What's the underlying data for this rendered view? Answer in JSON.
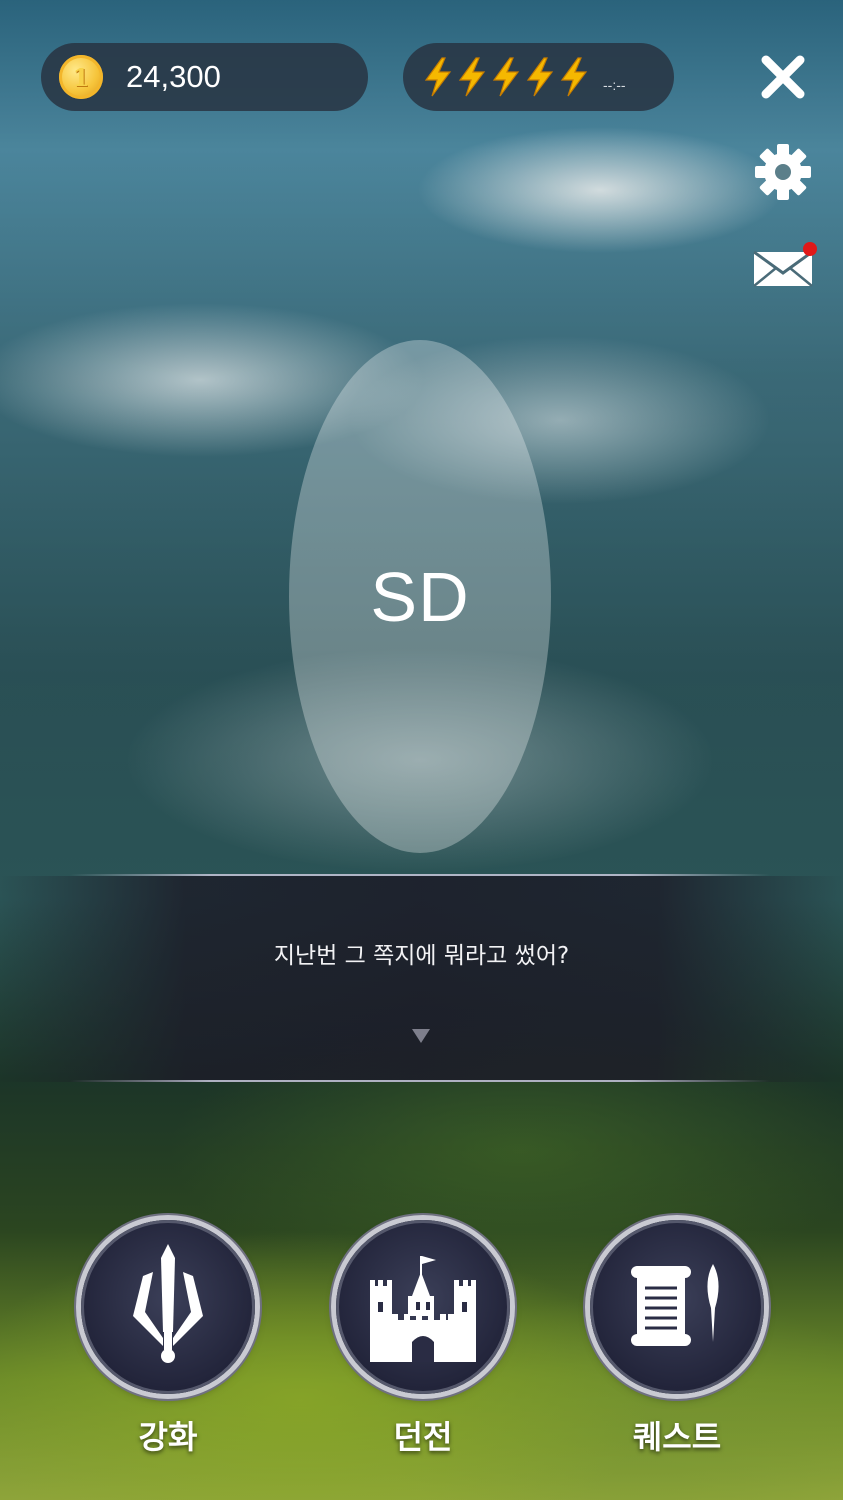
{
  "hud": {
    "gold": "24,300",
    "coin_symbol": "1",
    "energy_count": 5,
    "energy_timer": "--:--"
  },
  "icons": {
    "close": "close-icon",
    "settings": "gear-icon",
    "mail": "mail-icon",
    "upgrade": "sword-icon",
    "dungeon": "castle-icon",
    "quest": "scroll-icon"
  },
  "portrait": {
    "label": "SD"
  },
  "dialog": {
    "text": "지난번 그 쪽지에 뭐라고 썼어?"
  },
  "menu": {
    "upgrade_label": "강화",
    "dungeon_label": "던전",
    "quest_label": "퀘스트"
  },
  "colors": {
    "bolt": "#f5b800",
    "notification": "#e01818",
    "coin": "#f6c43a"
  }
}
